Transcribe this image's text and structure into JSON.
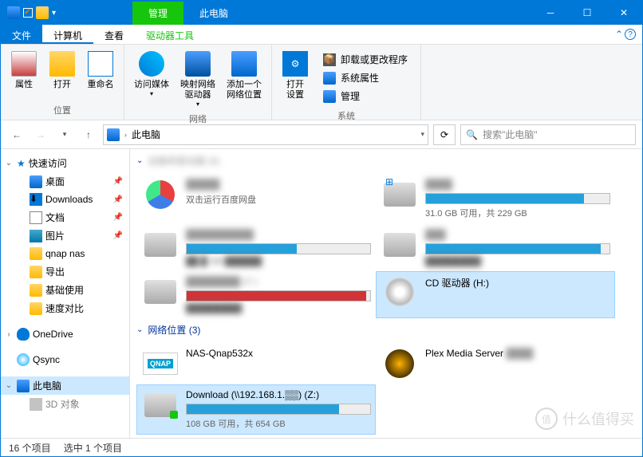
{
  "title_context_tab": "管理",
  "window_title": "此电脑",
  "ribbon_tabs": {
    "file": "文件",
    "computer": "计算机",
    "view": "查看",
    "drive_tools": "驱动器工具"
  },
  "ribbon": {
    "group_location": {
      "label": "位置",
      "btns": {
        "properties": "属性",
        "open": "打开",
        "rename": "重命名"
      }
    },
    "group_network": {
      "label": "网络",
      "btns": {
        "media": "访问媒体",
        "map": "映射网络\n驱动器",
        "addloc": "添加一个\n网络位置"
      }
    },
    "group_system": {
      "label": "系统",
      "open_settings": "打开\n设置",
      "items": {
        "uninstall": "卸载或更改程序",
        "sysprops": "系统属性",
        "manage": "管理"
      }
    }
  },
  "addressbar": {
    "location": "此电脑"
  },
  "search_placeholder": "搜索\"此电脑\"",
  "sidebar": {
    "quick": "快速访问",
    "items": [
      "桌面",
      "Downloads",
      "文档",
      "图片",
      "qnap nas",
      "导出",
      "基础使用",
      "速度对比"
    ],
    "onedrive": "OneDrive",
    "qsync": "Qsync",
    "thispc": "此电脑",
    "obj3d": "3D 对象"
  },
  "sections": {
    "devices": "设备和驱动器 (6)",
    "network": "网络位置 (3)"
  },
  "drives": {
    "baidu": {
      "sub": "双击运行百度网盘"
    },
    "c": {
      "stat": "31.0 GB 可用，共 229 GB",
      "fill": 86
    },
    "cd": {
      "name": "CD 驱动器 (H:)"
    },
    "nas": {
      "name": "NAS-Qnap532x"
    },
    "plex": {
      "name": "Plex Media Server"
    },
    "download": {
      "name": "Download (\\\\192.168.1.▒▒) (Z:)",
      "stat": "108 GB 可用，共 654 GB",
      "fill": 83
    }
  },
  "status": {
    "count": "16 个项目",
    "sel": "选中 1 个项目"
  },
  "watermark": "值 | 什么值得买"
}
